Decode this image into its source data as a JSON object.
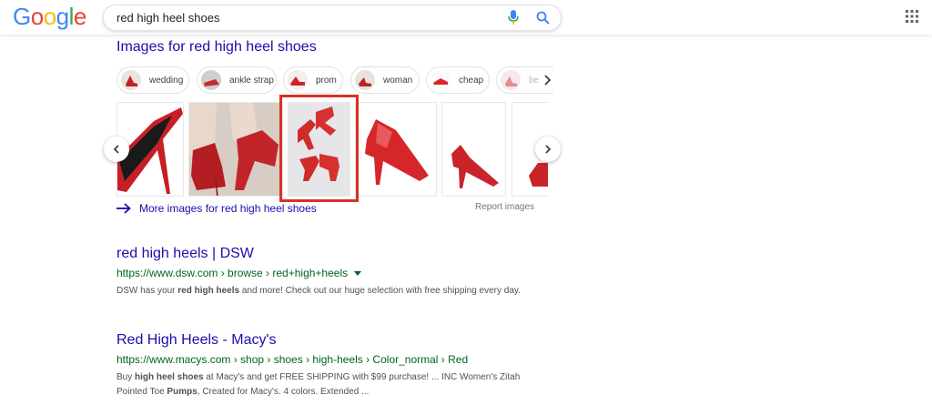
{
  "header": {
    "logo": [
      "G",
      "o",
      "o",
      "g",
      "l",
      "e"
    ],
    "logo_colors": [
      "#4285f4",
      "#ea4335",
      "#fbbc05",
      "#4285f4",
      "#34a853",
      "#ea4335"
    ],
    "search_query": "red high heel shoes"
  },
  "images": {
    "title": "Images for red high heel shoes",
    "chips": [
      "wedding",
      "ankle strap",
      "prom",
      "woman",
      "cheap",
      "be"
    ],
    "more_label": "More images for red high heel shoes",
    "report_label": "Report images"
  },
  "results": [
    {
      "title": "red high heels | DSW",
      "url": "https://www.dsw.com › browse › red+high+heels",
      "snippet_parts": [
        "DSW has your ",
        "red high heels",
        " and more! Check out our huge selection with free shipping every day."
      ]
    },
    {
      "title": "Red High Heels - Macy's",
      "url": "https://www.macys.com › shop › shoes › high-heels › Color_normal › Red",
      "snippet_parts": [
        "Buy ",
        "high heel shoes",
        " at Macy's and get FREE SHIPPING with $99 purchase! ... INC Women's Zitah Pointed Toe ",
        "Pumps",
        ", Created for Macy's. 4 colors. Extended ..."
      ]
    }
  ],
  "colors": {
    "link": "#1a0dab",
    "url": "#006621",
    "highlight": "#d93025",
    "shoe_red": "#d42a2a"
  }
}
